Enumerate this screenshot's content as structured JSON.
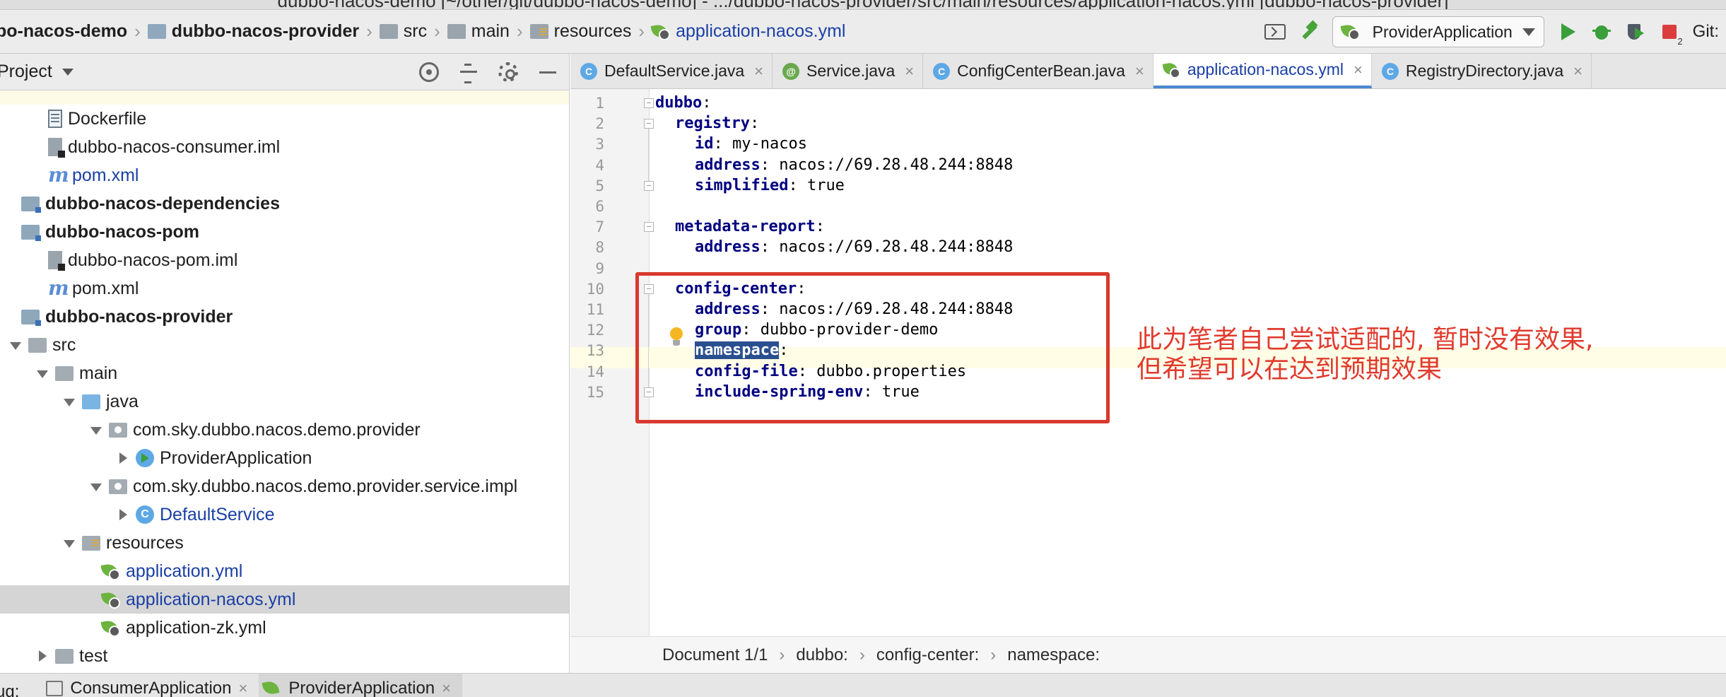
{
  "window": {
    "title": "dubbo-nacos-demo [~/other/git/dubbo-nacos-demo] - .../dubbo-nacos-provider/src/main/resources/application-nacos.yml [dubbo-nacos-provider]"
  },
  "navbar": {
    "crumbs": [
      {
        "label": "bo-nacos-demo",
        "icon": "none",
        "bold": true
      },
      {
        "label": "dubbo-nacos-provider",
        "icon": "module-folder-icon",
        "bold": true
      },
      {
        "label": "src",
        "icon": "folder-icon",
        "bold": false
      },
      {
        "label": "main",
        "icon": "folder-icon",
        "bold": false
      },
      {
        "label": "resources",
        "icon": "resources-folder-icon",
        "bold": false
      },
      {
        "label": "application-nacos.yml",
        "icon": "spring-yaml-icon",
        "bold": false
      }
    ],
    "run_config": "ProviderApplication",
    "stop_badge": "2",
    "git_label": "Git:"
  },
  "project_panel": {
    "title": "Project",
    "tree": [
      {
        "label": "",
        "indent": 0,
        "twisty": "none",
        "icon": "none",
        "partial": true
      },
      {
        "label": "Dockerfile",
        "indent": 1,
        "twisty": "none",
        "icon": "file-icon"
      },
      {
        "label": "dubbo-nacos-consumer.iml",
        "indent": 1,
        "twisty": "none",
        "icon": "iml-icon"
      },
      {
        "label": "pom.xml",
        "indent": 1,
        "twisty": "none",
        "icon": "maven-icon",
        "link": true
      },
      {
        "label": "dubbo-nacos-dependencies",
        "indent": 0,
        "twisty": "none",
        "icon": "module-folder-icon",
        "bold": true
      },
      {
        "label": "dubbo-nacos-pom",
        "indent": 0,
        "twisty": "none",
        "icon": "module-folder-icon",
        "bold": true
      },
      {
        "label": "dubbo-nacos-pom.iml",
        "indent": 1,
        "twisty": "none",
        "icon": "iml-icon"
      },
      {
        "label": "pom.xml",
        "indent": 1,
        "twisty": "none",
        "icon": "maven-icon"
      },
      {
        "label": "dubbo-nacos-provider",
        "indent": 0,
        "twisty": "none",
        "icon": "module-folder-icon",
        "bold": true
      },
      {
        "label": "src",
        "indent": 0,
        "twisty": "open",
        "icon": "folder-icon"
      },
      {
        "label": "main",
        "indent": 1,
        "twisty": "open",
        "icon": "folder-icon"
      },
      {
        "label": "java",
        "indent": 2,
        "twisty": "open",
        "icon": "source-folder-icon"
      },
      {
        "label": "com.sky.dubbo.nacos.demo.provider",
        "indent": 3,
        "twisty": "open",
        "icon": "package-icon"
      },
      {
        "label": "ProviderApplication",
        "indent": 4,
        "twisty": "closed",
        "icon": "run-class-icon"
      },
      {
        "label": "com.sky.dubbo.nacos.demo.provider.service.impl",
        "indent": 3,
        "twisty": "open",
        "icon": "package-icon"
      },
      {
        "label": "DefaultService",
        "indent": 4,
        "twisty": "closed",
        "icon": "class-icon",
        "link": true
      },
      {
        "label": "resources",
        "indent": 2,
        "twisty": "open",
        "icon": "resources-folder-icon"
      },
      {
        "label": "application.yml",
        "indent": 3,
        "twisty": "none",
        "icon": "spring-yaml-icon",
        "link": true
      },
      {
        "label": "application-nacos.yml",
        "indent": 3,
        "twisty": "none",
        "icon": "spring-yaml-icon",
        "link": true,
        "selected": true
      },
      {
        "label": "application-zk.yml",
        "indent": 3,
        "twisty": "none",
        "icon": "spring-yaml-icon"
      },
      {
        "label": "test",
        "indent": 1,
        "twisty": "closed",
        "icon": "folder-icon"
      }
    ]
  },
  "editor": {
    "tabs": [
      {
        "label": "DefaultService.java",
        "icon": "class-icon",
        "glyph": "C",
        "active": false
      },
      {
        "label": "Service.java",
        "icon": "annotation-icon",
        "glyph": "@",
        "active": false
      },
      {
        "label": "ConfigCenterBean.java",
        "icon": "class-icon",
        "glyph": "C",
        "active": false
      },
      {
        "label": "application-nacos.yml",
        "icon": "spring-yaml-icon",
        "glyph": "",
        "active": true
      },
      {
        "label": "RegistryDirectory.java",
        "icon": "class-icon",
        "glyph": "C",
        "active": false
      }
    ],
    "lines": [
      {
        "n": "1",
        "indent": 0,
        "key": "dubbo",
        "value": ""
      },
      {
        "n": "2",
        "indent": 1,
        "key": "registry",
        "value": ""
      },
      {
        "n": "3",
        "indent": 2,
        "key": "id",
        "value": " my-nacos"
      },
      {
        "n": "4",
        "indent": 2,
        "key": "address",
        "value": " nacos://69.28.48.244:8848"
      },
      {
        "n": "5",
        "indent": 2,
        "key": "simplified",
        "value": " true"
      },
      {
        "n": "6",
        "indent": 0,
        "key": "",
        "value": ""
      },
      {
        "n": "7",
        "indent": 1,
        "key": "metadata-report",
        "value": ""
      },
      {
        "n": "8",
        "indent": 2,
        "key": "address",
        "value": " nacos://69.28.48.244:8848"
      },
      {
        "n": "9",
        "indent": 0,
        "key": "",
        "value": ""
      },
      {
        "n": "10",
        "indent": 1,
        "key": "config-center",
        "value": ""
      },
      {
        "n": "11",
        "indent": 2,
        "key": "address",
        "value": " nacos://69.28.48.244:8848"
      },
      {
        "n": "12",
        "indent": 2,
        "key": "group",
        "value": " dubbo-provider-demo"
      },
      {
        "n": "13",
        "indent": 2,
        "key": "namespace",
        "value": "",
        "selected": true
      },
      {
        "n": "14",
        "indent": 2,
        "key": "config-file",
        "value": " dubbo.properties"
      },
      {
        "n": "15",
        "indent": 2,
        "key": "include-spring-env",
        "value": " true"
      }
    ],
    "annotation": [
      "此为笔者自己尝试适配的, 暂时没有效果,",
      "但希望可以在达到预期效果"
    ],
    "breadcrumbs": [
      "Document 1/1",
      "dubbo:",
      "config-center:",
      "namespace:"
    ]
  },
  "bottom": {
    "label": "ug:",
    "tabs": [
      {
        "label": "ConsumerApplication",
        "active": false
      },
      {
        "label": "ProviderApplication",
        "active": true
      }
    ]
  },
  "colors": {
    "annotation_red": "#e03b2d",
    "yaml_key": "#000080",
    "link_blue": "#1a3fa5"
  }
}
